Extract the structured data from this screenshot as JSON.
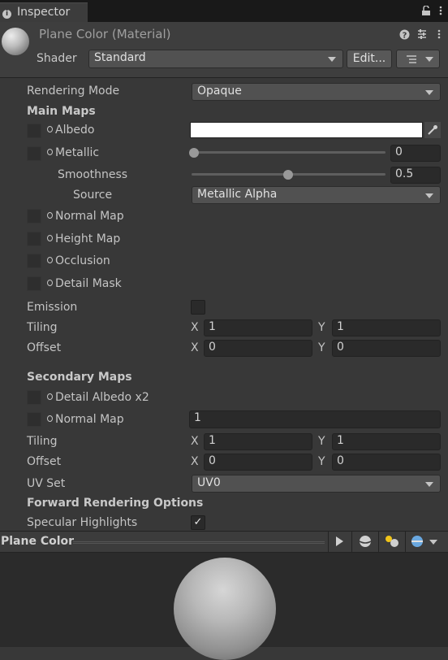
{
  "tab": {
    "label": "Inspector"
  },
  "header": {
    "title": "Plane Color (Material)",
    "shader_label": "Shader",
    "shader_value": "Standard",
    "edit_label": "Edit..."
  },
  "props": {
    "rendering_mode": {
      "label": "Rendering Mode",
      "value": "Opaque"
    },
    "main_maps": "Main Maps",
    "albedo": {
      "label": "Albedo",
      "color": "#ffffff"
    },
    "metallic": {
      "label": "Metallic",
      "value": "0",
      "fraction": 0
    },
    "smoothness": {
      "label": "Smoothness",
      "value": "0.5",
      "fraction": 0.5
    },
    "source": {
      "label": "Source",
      "value": "Metallic Alpha"
    },
    "normal_map": "Normal Map",
    "height_map": "Height Map",
    "occlusion": "Occlusion",
    "detail_mask": "Detail Mask",
    "emission": {
      "label": "Emission",
      "checked": false
    },
    "tiling": {
      "label": "Tiling",
      "x": "1",
      "y": "1"
    },
    "offset": {
      "label": "Offset",
      "x": "0",
      "y": "0"
    }
  },
  "secondary": {
    "title": "Secondary Maps",
    "detail_albedo": "Detail Albedo x2",
    "normal_map": {
      "label": "Normal Map",
      "value": "1"
    },
    "tiling": {
      "label": "Tiling",
      "x": "1",
      "y": "1"
    },
    "offset": {
      "label": "Offset",
      "x": "0",
      "y": "0"
    },
    "uv_set": {
      "label": "UV Set",
      "value": "UV0"
    }
  },
  "forward": {
    "title": "Forward Rendering Options",
    "specular": {
      "label": "Specular Highlights",
      "checked": true
    }
  },
  "axis": {
    "x": "X",
    "y": "Y"
  },
  "preview": {
    "title": "Plane Color"
  }
}
